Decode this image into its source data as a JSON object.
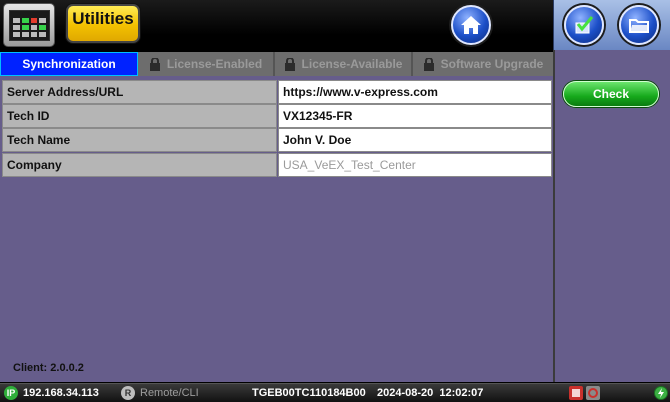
{
  "header": {
    "app_title": "Utilities",
    "icons": {
      "app": "instrument-icon",
      "home": "home-icon",
      "save": "save-icon",
      "open": "folder-icon"
    }
  },
  "tabs": [
    {
      "label": "Synchronization",
      "active": true,
      "locked": false
    },
    {
      "label": "License-Enabled",
      "active": false,
      "locked": true
    },
    {
      "label": "License-Available",
      "active": false,
      "locked": true
    },
    {
      "label": "Software Upgrade",
      "active": false,
      "locked": true
    }
  ],
  "fields": {
    "server": {
      "label": "Server Address/URL",
      "value": "https://www.v-express.com"
    },
    "tech_id": {
      "label": "Tech ID",
      "value": "VX12345-FR"
    },
    "tech_name": {
      "label": "Tech Name",
      "value": "John V. Doe"
    },
    "company": {
      "label": "Company",
      "placeholder": "USA_VeEX_Test_Center"
    }
  },
  "client_version": "Client: 2.0.0.2",
  "side": {
    "check_label": "Check"
  },
  "status": {
    "ip_badge": "IP",
    "ip": "192.168.34.113",
    "remote_badge": "R",
    "remote": "Remote/CLI",
    "serial": "TGEB00TC110184B00",
    "datetime": "2024-08-20  12:02:07"
  },
  "colors": {
    "tab_active": "#0022ff",
    "panel_bg": "#665d8b",
    "check_button": "#16a91c",
    "title_button": "#f3c100"
  }
}
